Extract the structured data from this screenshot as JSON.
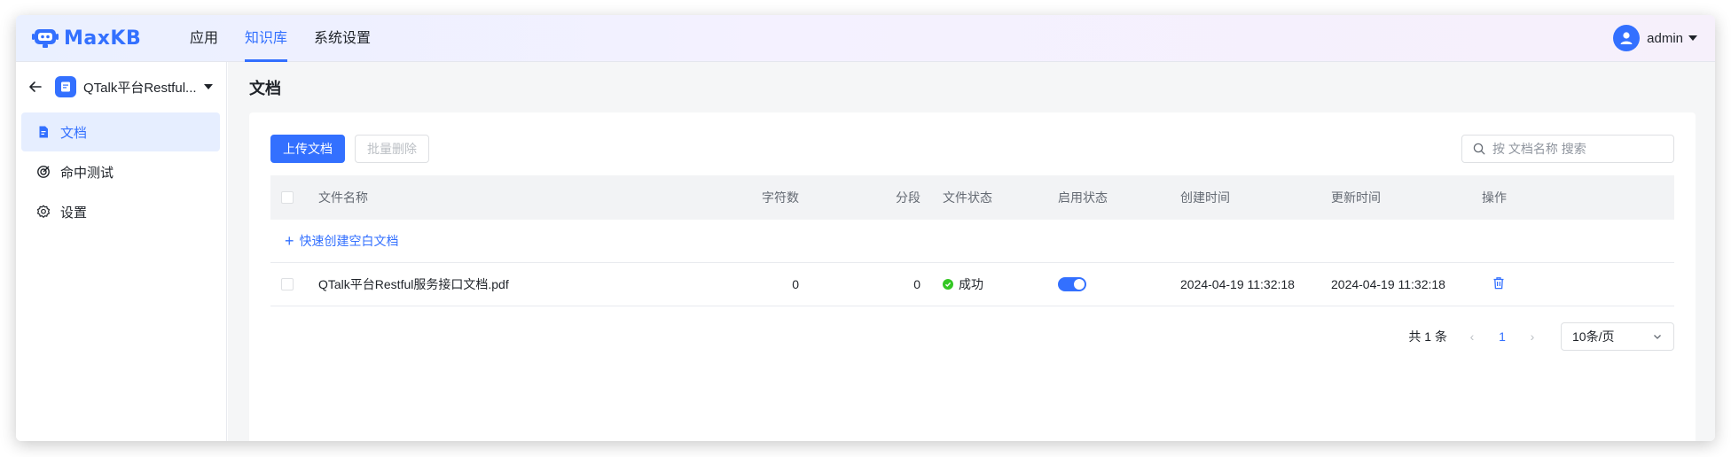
{
  "app": {
    "brand": "MaxKB"
  },
  "topnav": {
    "items": [
      {
        "label": "应用"
      },
      {
        "label": "知识库"
      },
      {
        "label": "系统设置"
      }
    ],
    "active_index": 1
  },
  "user": {
    "name": "admin"
  },
  "sidebar": {
    "kb_name": "QTalk平台Restful...",
    "menu": [
      {
        "label": "文档",
        "icon": "document-icon"
      },
      {
        "label": "命中测试",
        "icon": "target-icon"
      },
      {
        "label": "设置",
        "icon": "gear-icon"
      }
    ],
    "active_index": 0
  },
  "main": {
    "title": "文档",
    "upload_label": "上传文档",
    "batch_delete_label": "批量删除",
    "search_placeholder": "按 文档名称 搜索"
  },
  "table": {
    "headers": {
      "name": "文件名称",
      "chars": "字符数",
      "segments": "分段",
      "file_status": "文件状态",
      "enable_status": "启用状态",
      "created": "创建时间",
      "updated": "更新时间",
      "ops": "操作"
    },
    "quick_create": "快速创建空白文档",
    "rows": [
      {
        "name": "QTalk平台Restful服务接口文档.pdf",
        "chars": "0",
        "segments": "0",
        "status": "成功",
        "enabled": true,
        "created": "2024-04-19 11:32:18",
        "updated": "2024-04-19 11:32:18"
      }
    ]
  },
  "pagination": {
    "total": "共 1 条",
    "current": "1",
    "page_size": "10条/页"
  },
  "colors": {
    "accent": "#3370ff",
    "success": "#34c724"
  }
}
